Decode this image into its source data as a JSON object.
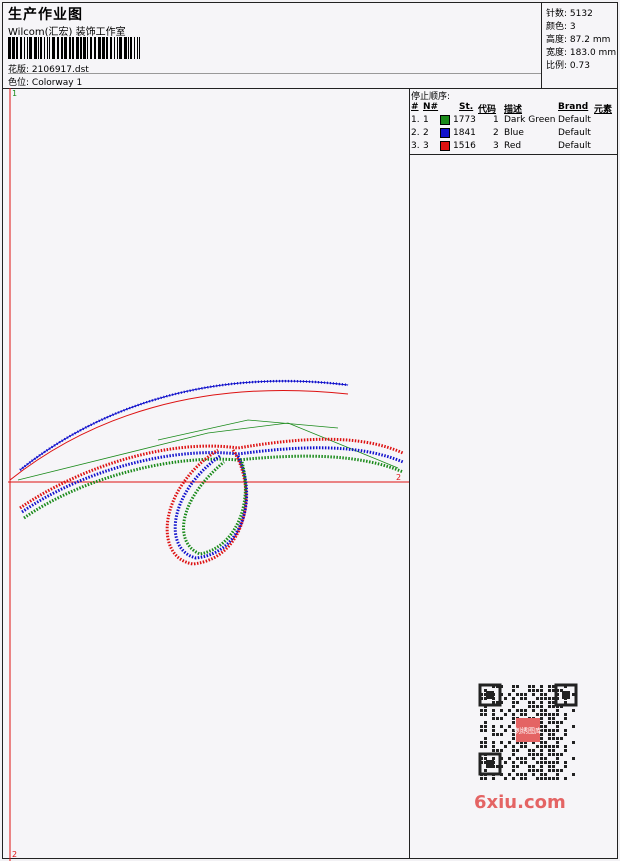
{
  "header": {
    "title": "生产作业图",
    "subtitle": "Wilcom(汇宏) 装饰工作室",
    "design_label": "花版:",
    "design_file": "2106917.dst",
    "colorway_label": "色位:",
    "colorway": "Colorway 1"
  },
  "stats": [
    {
      "label": "针数:",
      "value": "5132"
    },
    {
      "label": "颜色:",
      "value": "3"
    },
    {
      "label": "高度:",
      "value": "87.2 mm"
    },
    {
      "label": "宽度:",
      "value": "183.0 mm"
    },
    {
      "label": "比例:",
      "value": "0.73"
    }
  ],
  "stop_sequence": {
    "title": "停止顺序:",
    "columns": [
      "#",
      "N#",
      "St.",
      "代码",
      "描述",
      "Brand",
      "元素"
    ],
    "rows": [
      {
        "idx": "1.",
        "n": "1",
        "color": "#1a8a1a",
        "st": "1773",
        "code": "1",
        "desc": "Dark Green",
        "brand": "Default"
      },
      {
        "idx": "2.",
        "n": "2",
        "color": "#1010cc",
        "st": "1841",
        "code": "2",
        "desc": "Blue",
        "brand": "Default"
      },
      {
        "idx": "3.",
        "n": "3",
        "color": "#dd1111",
        "st": "1516",
        "code": "3",
        "desc": "Red",
        "brand": "Default"
      }
    ]
  },
  "canvas": {
    "marker_top": "1",
    "marker_right": "2",
    "marker_bottom": "2"
  },
  "watermark": {
    "site": "6xiu.com",
    "seal": "刺绣图库"
  },
  "colors": {
    "green": "#1a8a1a",
    "blue": "#1010cc",
    "red": "#dd1111",
    "axis": "#dd1111"
  }
}
